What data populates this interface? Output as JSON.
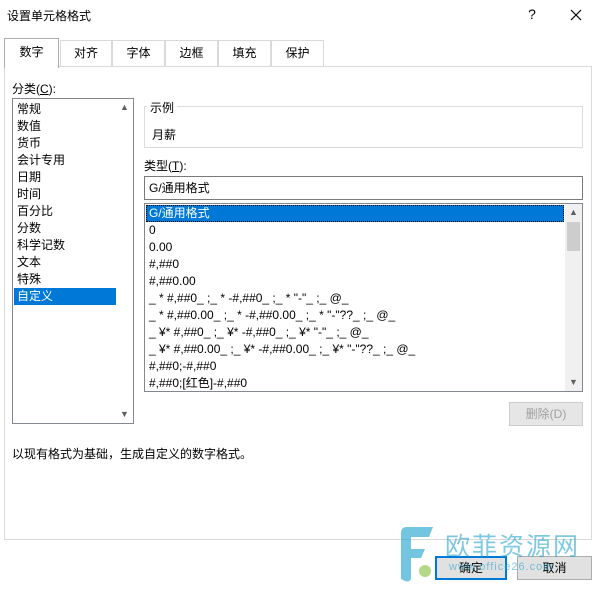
{
  "window": {
    "title": "设置单元格格式",
    "help_symbol": "?"
  },
  "tabs": [
    {
      "label": "数字",
      "active": true
    },
    {
      "label": "对齐",
      "active": false
    },
    {
      "label": "字体",
      "active": false
    },
    {
      "label": "边框",
      "active": false
    },
    {
      "label": "填充",
      "active": false
    },
    {
      "label": "保护",
      "active": false
    }
  ],
  "category": {
    "label_prefix": "分类(",
    "label_key": "C",
    "label_suffix": "):",
    "items": [
      "常规",
      "数值",
      "货币",
      "会计专用",
      "日期",
      "时间",
      "百分比",
      "分数",
      "科学记数",
      "文本",
      "特殊",
      "自定义"
    ],
    "selected_index": 11
  },
  "sample": {
    "legend": "示例",
    "value": "月薪"
  },
  "type": {
    "label_prefix": "类型(",
    "label_key": "T",
    "label_suffix": "):",
    "input_value": "G/通用格式",
    "formats": [
      "G/通用格式",
      "0",
      "0.00",
      "#,##0",
      "#,##0.00",
      "_ * #,##0_ ;_ * -#,##0_ ;_ * \"-\"_ ;_ @_",
      "_ * #,##0.00_ ;_ * -#,##0.00_ ;_ * \"-\"??_ ;_ @_",
      "_ ¥* #,##0_ ;_ ¥* -#,##0_ ;_ ¥* \"-\"_ ;_ @_",
      "_ ¥* #,##0.00_ ;_ ¥* -#,##0.00_ ;_ ¥* \"-\"??_ ;_ @_",
      "#,##0;-#,##0",
      "#,##0;[红色]-#,##0"
    ],
    "selected_index": 0
  },
  "buttons": {
    "delete": "删除(D)",
    "ok": "确定",
    "cancel": "取消"
  },
  "description": "以现有格式为基础，生成自定义的数字格式。",
  "watermark": {
    "text": "欧菲资源网",
    "url": "www.office26.com"
  },
  "colors": {
    "selection": "#0078d7",
    "watermark": "#2aa6cf",
    "watermark_green": "#8bc34a"
  }
}
